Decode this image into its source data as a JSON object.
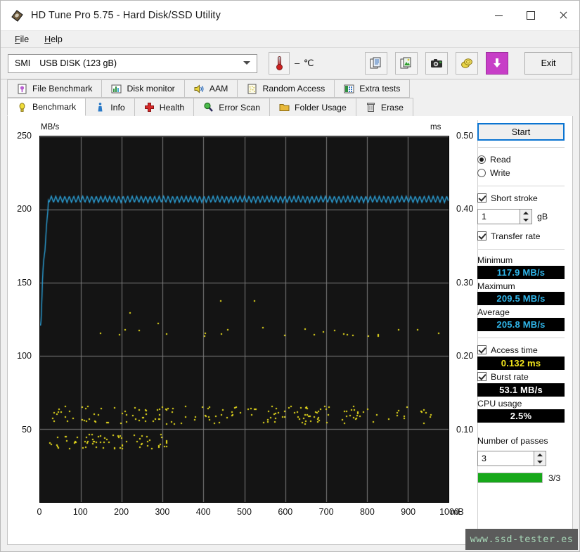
{
  "window": {
    "title": "HD Tune Pro 5.75 - Hard Disk/SSD Utility",
    "app_icon": "hdd-icon",
    "minimize": "minimize-icon",
    "maximize": "maximize-icon",
    "close": "close-icon"
  },
  "menu": {
    "items": [
      "File",
      "Help"
    ]
  },
  "toolbar": {
    "device_vendor": "SMI",
    "device_model": "USB DISK (123 gB)",
    "temperature": "– ℃",
    "buttons": [
      {
        "name": "copy-text-button",
        "icon": "copy-text-icon"
      },
      {
        "name": "copy-image-button",
        "icon": "copy-image-icon"
      },
      {
        "name": "screenshot-button",
        "icon": "camera-icon"
      },
      {
        "name": "donate-button",
        "icon": "coins-icon"
      },
      {
        "name": "download-button",
        "icon": "download-arrow-icon"
      }
    ],
    "exit_label": "Exit"
  },
  "tabs": {
    "top_row": [
      {
        "label": "File Benchmark",
        "icon": "file-benchmark-icon",
        "active": false
      },
      {
        "label": "Disk monitor",
        "icon": "disk-monitor-icon",
        "active": false
      },
      {
        "label": "AAM",
        "icon": "speaker-icon",
        "active": false
      },
      {
        "label": "Random Access",
        "icon": "random-access-icon",
        "active": false
      },
      {
        "label": "Extra tests",
        "icon": "extra-tests-icon",
        "active": false
      }
    ],
    "bottom_row": [
      {
        "label": "Benchmark",
        "icon": "lightbulb-icon",
        "active": true
      },
      {
        "label": "Info",
        "icon": "info-icon",
        "active": false
      },
      {
        "label": "Health",
        "icon": "health-cross-icon",
        "active": false
      },
      {
        "label": "Error Scan",
        "icon": "magnifier-icon",
        "active": false
      },
      {
        "label": "Folder Usage",
        "icon": "folder-icon",
        "active": false
      },
      {
        "label": "Erase",
        "icon": "trash-icon",
        "active": false
      }
    ]
  },
  "panel": {
    "start_label": "Start",
    "mode": {
      "read_label": "Read",
      "write_label": "Write",
      "selected": "Read"
    },
    "short_stroke": {
      "label": "Short stroke",
      "checked": true,
      "value": "1",
      "unit": "gB"
    },
    "transfer_rate": {
      "label": "Transfer rate",
      "checked": true
    },
    "minimum_label": "Minimum",
    "minimum_value": "117.9 MB/s",
    "maximum_label": "Maximum",
    "maximum_value": "209.5 MB/s",
    "average_label": "Average",
    "average_value": "205.8 MB/s",
    "access_time": {
      "label": "Access time",
      "checked": true,
      "value": "0.132 ms"
    },
    "burst_rate": {
      "label": "Burst rate",
      "checked": true,
      "value": "53.1 MB/s"
    },
    "cpu_usage_label": "CPU usage",
    "cpu_usage_value": "2.5%",
    "passes_label": "Number of passes",
    "passes_value": "3",
    "progress_text": "3/3",
    "progress_percent": 100,
    "colors": {
      "cyan": "#2fb4e8",
      "yellow": "#f2e51c",
      "white": "#ffffff",
      "green": "#17a81a",
      "accent_blue": "#0a74d1"
    }
  },
  "watermark": "www.ssd-tester.es",
  "chart_data": {
    "type": "line",
    "title": "",
    "xlabel": "mB",
    "ylabel": "MB/s",
    "y2label": "ms",
    "xlim": [
      0,
      1000
    ],
    "ylim": [
      0,
      250
    ],
    "y2lim": [
      0.0,
      0.5
    ],
    "xticks": [
      0,
      100,
      200,
      300,
      400,
      500,
      600,
      700,
      800,
      900,
      1000
    ],
    "yticks": [
      50,
      100,
      150,
      200,
      250
    ],
    "y2ticks": [
      "0.10",
      "0.20",
      "0.30",
      "0.40",
      "0.50"
    ],
    "grid": true,
    "legend": "none",
    "background": "#141414",
    "series": [
      {
        "name": "Transfer rate",
        "type": "line",
        "color": "#2b9fd6",
        "axis": "left",
        "unit": "MB/s",
        "x": [
          0,
          2,
          4,
          6,
          8,
          10,
          12,
          14,
          16,
          18,
          20,
          24,
          30,
          40,
          50,
          60,
          80,
          100,
          150,
          200,
          250,
          300,
          350,
          400,
          450,
          500,
          550,
          600,
          650,
          700,
          750,
          800,
          850,
          900,
          950,
          1000
        ],
        "y": [
          121,
          121,
          135,
          152,
          163,
          168,
          172,
          181,
          190,
          196,
          202,
          206,
          207,
          208,
          207,
          208,
          206,
          208,
          207,
          208,
          206,
          208,
          207,
          208,
          206,
          208,
          207,
          208,
          206,
          208,
          207,
          208,
          206,
          208,
          207,
          208
        ],
        "oscillation": {
          "amplitude": 2.2,
          "period_mb": 11,
          "plateau_mean": 207
        }
      },
      {
        "name": "Access time",
        "type": "scatter",
        "color": "#f2e51c",
        "axis": "right",
        "unit": "ms",
        "clusters": [
          {
            "label": "upper band",
            "y_mbps_equiv": 117,
            "ms": 0.232,
            "count": 22,
            "x_range": [
              40,
              1000
            ],
            "spread_ms": 0.006
          },
          {
            "label": "mid band",
            "y_mbps_equiv": 60,
            "ms": 0.12,
            "count": 170,
            "x_range": [
              20,
              960
            ],
            "spread_ms": 0.012
          },
          {
            "label": "lower band",
            "y_mbps_equiv": 42,
            "ms": 0.084,
            "count": 70,
            "x_range": [
              20,
              320
            ],
            "spread_ms": 0.01
          },
          {
            "label": "outliers",
            "y_mbps_equiv": 128,
            "ms": 0.256,
            "count": 6,
            "x_range": [
              130,
              620
            ],
            "spread_ms": 0.03
          }
        ],
        "reported_average_ms": "0.132 ms"
      }
    ]
  }
}
